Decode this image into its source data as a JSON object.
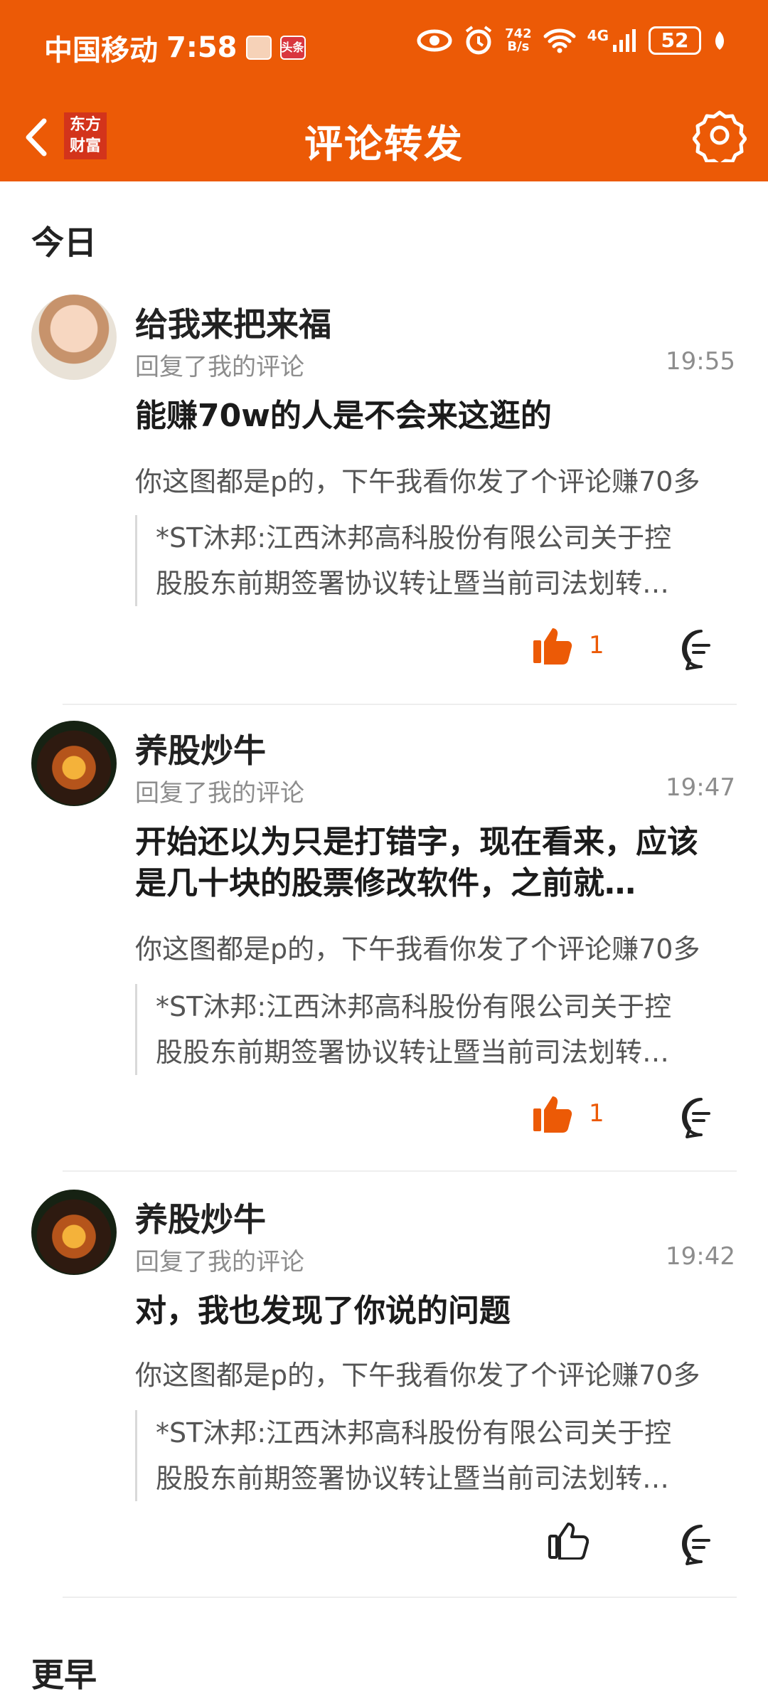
{
  "status_bar": {
    "carrier": "中国移动",
    "time": "7:58",
    "toutiao_badge": "头条",
    "net_speed_top": "742",
    "net_speed_bottom": "B/s",
    "network": "4G",
    "battery": "52"
  },
  "header": {
    "logo_line1": "东方",
    "logo_line2": "财富",
    "title": "评论转发"
  },
  "sections": {
    "today": "今日",
    "earlier": "更早"
  },
  "items": [
    {
      "username": "给我来把来福",
      "subinfo": "回复了我的评论",
      "time": "19:55",
      "reply": "能赚70w的人是不会来这逛的",
      "original": "你这图都是p的，下午我看你发了个评论赚70多",
      "quote_line1": "*ST沐邦:江西沐邦高科股份有限公司关于控",
      "quote_line2": "股股东前期签署协议转让暨当前司法划转…",
      "likes": "1",
      "liked": true
    },
    {
      "username": "养股炒牛",
      "subinfo": "回复了我的评论",
      "time": "19:47",
      "reply": "开始还以为只是打错字，现在看来，应该是几十块的股票修改软件，之前就…",
      "original": "你这图都是p的，下午我看你发了个评论赚70多",
      "quote_line1": "*ST沐邦:江西沐邦高科股份有限公司关于控",
      "quote_line2": "股股东前期签署协议转让暨当前司法划转…",
      "likes": "1",
      "liked": true
    },
    {
      "username": "养股炒牛",
      "subinfo": "回复了我的评论",
      "time": "19:42",
      "reply": "对，我也发现了你说的问题",
      "original": "你这图都是p的，下午我看你发了个评论赚70多",
      "quote_line1": "*ST沐邦:江西沐邦高科股份有限公司关于控",
      "quote_line2": "股股东前期签署协议转让暨当前司法划转…",
      "likes": "",
      "liked": false
    }
  ],
  "colors": {
    "brand": "#ec5a06",
    "text_primary": "#222222",
    "text_secondary": "#8d8d8d"
  }
}
